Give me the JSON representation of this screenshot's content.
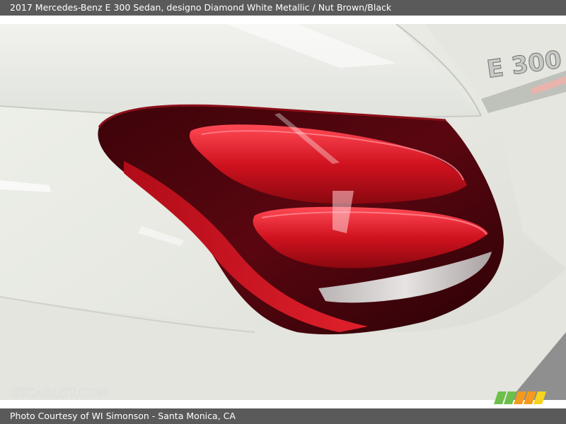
{
  "header": {
    "title": "2017 Mercedes-Benz E 300 Sedan,   designo Diamond White Metallic / Nut Brown/Black"
  },
  "photo": {
    "badge_text": "E 300",
    "watermark": "GTCARLOT.COM",
    "subject": "tail light"
  },
  "footer": {
    "credit": "Photo Courtesy of WI Simonson - Santa Monica, CA"
  },
  "colors": {
    "bar": "#5a5a5a",
    "paint": "#e9eae4",
    "lamp_dark": "#5a0610",
    "lamp_red": "#c8101e",
    "logo_green": "#6cc04a",
    "logo_orange": "#f39a1e",
    "logo_yellow": "#f6d31d"
  }
}
